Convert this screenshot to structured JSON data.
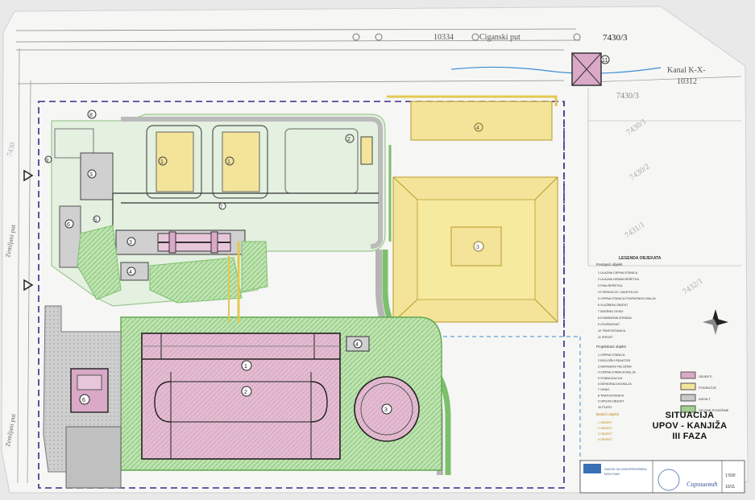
{
  "drawing": {
    "roads": {
      "top_road_number": "10334",
      "top_road_name": "Ciganski  put",
      "side_road_name_1": "Zemljani put",
      "side_road_name_2": "Zemljani put",
      "canal_label": "Kanal  K-X-",
      "canal_number": "10312",
      "left_parcel": "7430"
    },
    "parcels": [
      "7430/3",
      "7430/3",
      "7430/1",
      "7430/2",
      "7431/1",
      "7432/1"
    ],
    "zones": {
      "z1a": "1",
      "z1b": "1",
      "z2": "2",
      "z3": "3",
      "z4": "4",
      "z5": "5",
      "z6": "6",
      "z7": "7",
      "z8": "8",
      "z9": "9",
      "z10": "10",
      "z11": "11",
      "tank_1": "1",
      "tank_2": "2",
      "clarifier_3": "3",
      "tank_4": "4",
      "sludge_6": "6",
      "future_3": "3",
      "future_4": "4"
    },
    "legend": {
      "heading": "LEGENDA OBJEKATA",
      "existing_heading": "Postojeći objekti",
      "existing_items": [
        "1  ULAZNA CRPNA STANICA",
        "2  ULAZNA GRUBA REŠETKA",
        "3  FINA REŠETKA",
        "4  PJESKOLOV I MASTOLOV",
        "5  CRPNA STANICA POVRATNOG MULJA",
        "6  SLUŽBENI OBJEKT",
        "7  MJERNO OKNO",
        "8  KOMANDNA ZGRADA",
        "9  ZGUŠNJIVAČ",
        "10 TRAFOSTANICA",
        "11 ISPUST"
      ],
      "new_heading": "Projektirani objekti",
      "new_items": [
        "1  CRPNA STANICA",
        "2  BIOLOŠKI REAKTOR",
        "3  NAKNADNI TALOŽNIK",
        "4  CRPNA STANICA MULJA",
        "5  STABILIZACIJA",
        "6  DEHIDRACIJA MULJA",
        "7  OKNO",
        "8  TRAFOSTANICA",
        "9  SPOJNI OBJEKT",
        "10 PLATO"
      ],
      "future_heading": "Budući objekti",
      "future_items": [
        "1  OBJEKT",
        "2  OBJEKT",
        "3  OBJEKT",
        "4  OBJEKT"
      ],
      "color_keys": [
        {
          "label": "OBJEKTI",
          "color": "#d9a9c7"
        },
        {
          "label": "PODRUČJE",
          "color": "#f3e49a"
        },
        {
          "label": "ASFALT",
          "color": "#c9c9c9"
        },
        {
          "label": "ZELENE POVRŠINE",
          "color": "#9fd08f"
        }
      ]
    },
    "title": {
      "line1": "SITUACIJA",
      "line2": "UPOV - KANJIŽA",
      "line3": "III FAZA"
    },
    "stamp": {
      "company": "ZAVOD ZA VODOPRIVREDU",
      "sub": "NOVI SAD",
      "signature": "Сирошевић",
      "sheet": "10/11",
      "scale": "1:500"
    },
    "colors": {
      "paper": "#f6f6f4",
      "existing": "#d9a9c7",
      "projected_area": "#f3e49a",
      "green": "#8ccc7c",
      "asphalt": "#c9c9c9",
      "boundary": "#3a2a8a",
      "water": "#3b8fd6"
    }
  }
}
